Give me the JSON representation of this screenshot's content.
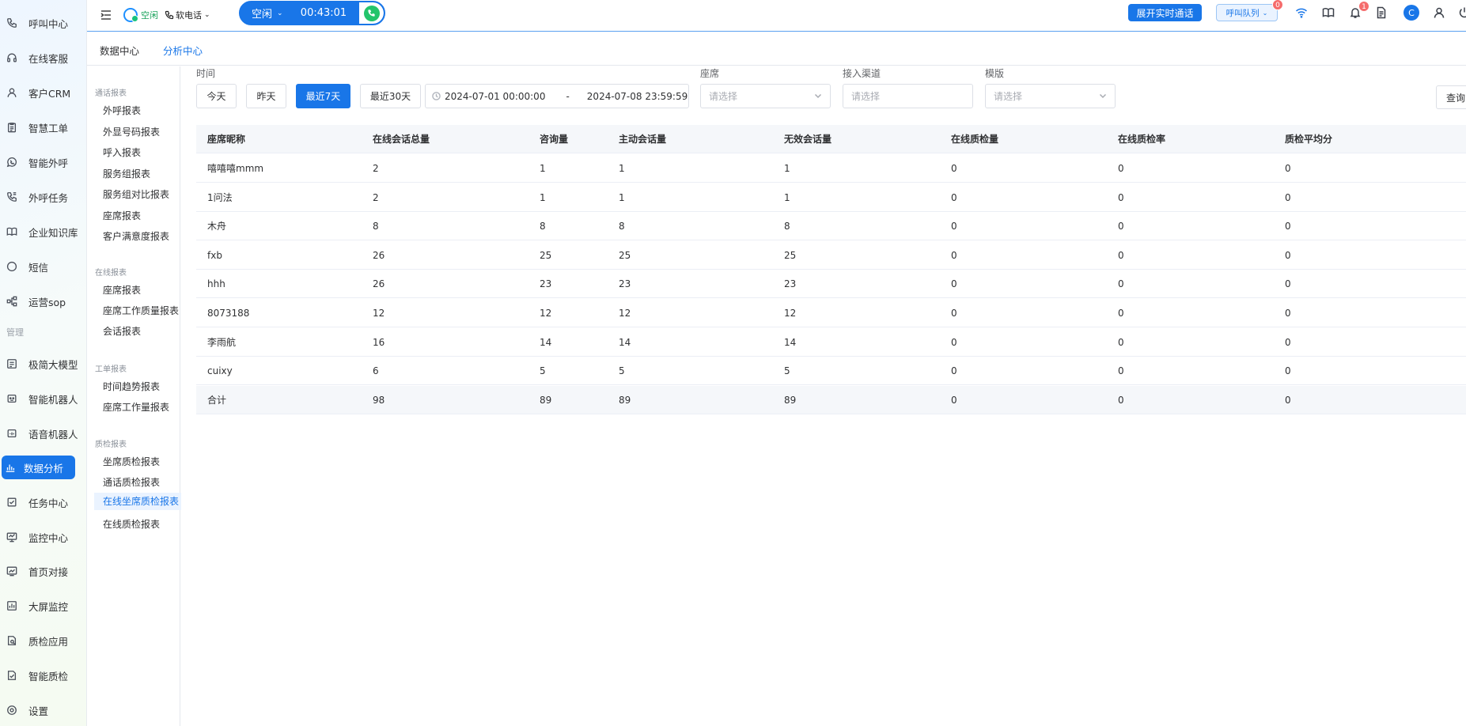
{
  "nav": {
    "items": [
      {
        "label": "呼叫中心",
        "icon": "phone-icon"
      },
      {
        "label": "在线客服",
        "icon": "headset-icon"
      },
      {
        "label": "客户CRM",
        "icon": "user-icon"
      },
      {
        "label": "智慧工单",
        "icon": "clipboard-icon"
      },
      {
        "label": "智能外呼",
        "icon": "whatsapp-icon"
      },
      {
        "label": "外呼任务",
        "icon": "outbound-call-icon"
      },
      {
        "label": "企业知识库",
        "icon": "book-icon"
      },
      {
        "label": "短信",
        "icon": "sms-icon"
      },
      {
        "label": "运营sop",
        "icon": "flow-icon"
      }
    ],
    "group_manage": "管理",
    "manage_items": [
      {
        "label": "极简大模型",
        "icon": "model-icon"
      },
      {
        "label": "智能机器人",
        "icon": "robot-icon"
      },
      {
        "label": "语音机器人",
        "icon": "voice-robot-icon"
      },
      {
        "label": "数据分析",
        "icon": "bar-chart-icon",
        "active": true
      },
      {
        "label": "任务中心",
        "icon": "task-icon"
      },
      {
        "label": "监控中心",
        "icon": "monitor-icon"
      },
      {
        "label": "首页对接",
        "icon": "dashboard-icon"
      },
      {
        "label": "大屏监控",
        "icon": "screen-chart-icon"
      },
      {
        "label": "质检应用",
        "icon": "qc-app-icon"
      },
      {
        "label": "智能质检",
        "icon": "qc-smart-icon"
      },
      {
        "label": "设置",
        "icon": "settings-icon"
      }
    ]
  },
  "topbar": {
    "status_label": "空闲",
    "phone_mode": "软电话",
    "call_state": "空闲",
    "call_timer": "00:43:01",
    "realtime_button": "展开实时通话",
    "queue_button": "呼叫队列",
    "queue_badge": "0",
    "notification_badge": "1",
    "avatar_letter": "C"
  },
  "subtabs": [
    {
      "label": "数据中心",
      "active": false
    },
    {
      "label": "分析中心",
      "active": true
    }
  ],
  "report_menu": {
    "groups": [
      {
        "title": "通话报表",
        "items": [
          "外呼报表",
          "外显号码报表",
          "呼入报表",
          "服务组报表",
          "服务组对比报表",
          "座席报表",
          "客户满意度报表"
        ]
      },
      {
        "title": "在线报表",
        "items": [
          "座席报表",
          "座席工作质量报表",
          "会话报表"
        ]
      },
      {
        "title": "工单报表",
        "items": [
          "时间趋势报表",
          "座席工作量报表"
        ]
      },
      {
        "title": "质检报表",
        "items": [
          "坐席质检报表",
          "通话质检报表",
          "在线坐席质检报表",
          "在线质检报表"
        ]
      }
    ],
    "active_item": "在线坐席质检报表"
  },
  "filters": {
    "time_label": "时间",
    "quick_buttons": [
      {
        "label": "今天",
        "active": false
      },
      {
        "label": "昨天",
        "active": false
      },
      {
        "label": "最近7天",
        "active": true
      },
      {
        "label": "最近30天",
        "active": false
      }
    ],
    "date_start": "2024-07-01 00:00:00",
    "date_separator": "-",
    "date_end": "2024-07-08 23:59:59",
    "agent_label": "座席",
    "agent_placeholder": "请选择",
    "channel_label": "接入渠道",
    "channel_placeholder": "请选择",
    "template_label": "模版",
    "template_placeholder": "请选择",
    "query_button": "查询"
  },
  "table": {
    "columns": [
      "座席昵称",
      "在线会话总量",
      "咨询量",
      "主动会话量",
      "无效会话量",
      "在线质检量",
      "在线质检率",
      "质检平均分"
    ],
    "rows": [
      [
        "嘻嘻嘻mmm",
        "2",
        "1",
        "1",
        "1",
        "0",
        "0",
        "0"
      ],
      [
        "1问法",
        "2",
        "1",
        "1",
        "1",
        "0",
        "0",
        "0"
      ],
      [
        "木舟",
        "8",
        "8",
        "8",
        "8",
        "0",
        "0",
        "0"
      ],
      [
        "fxb",
        "26",
        "25",
        "25",
        "25",
        "0",
        "0",
        "0"
      ],
      [
        "hhh",
        "26",
        "23",
        "23",
        "23",
        "0",
        "0",
        "0"
      ],
      [
        "8073188",
        "12",
        "12",
        "12",
        "12",
        "0",
        "0",
        "0"
      ],
      [
        "李雨航",
        "16",
        "14",
        "14",
        "14",
        "0",
        "0",
        "0"
      ],
      [
        "cuixy",
        "6",
        "5",
        "5",
        "5",
        "0",
        "0",
        "0"
      ]
    ],
    "total": [
      "合计",
      "98",
      "89",
      "89",
      "89",
      "0",
      "0",
      "0"
    ]
  }
}
